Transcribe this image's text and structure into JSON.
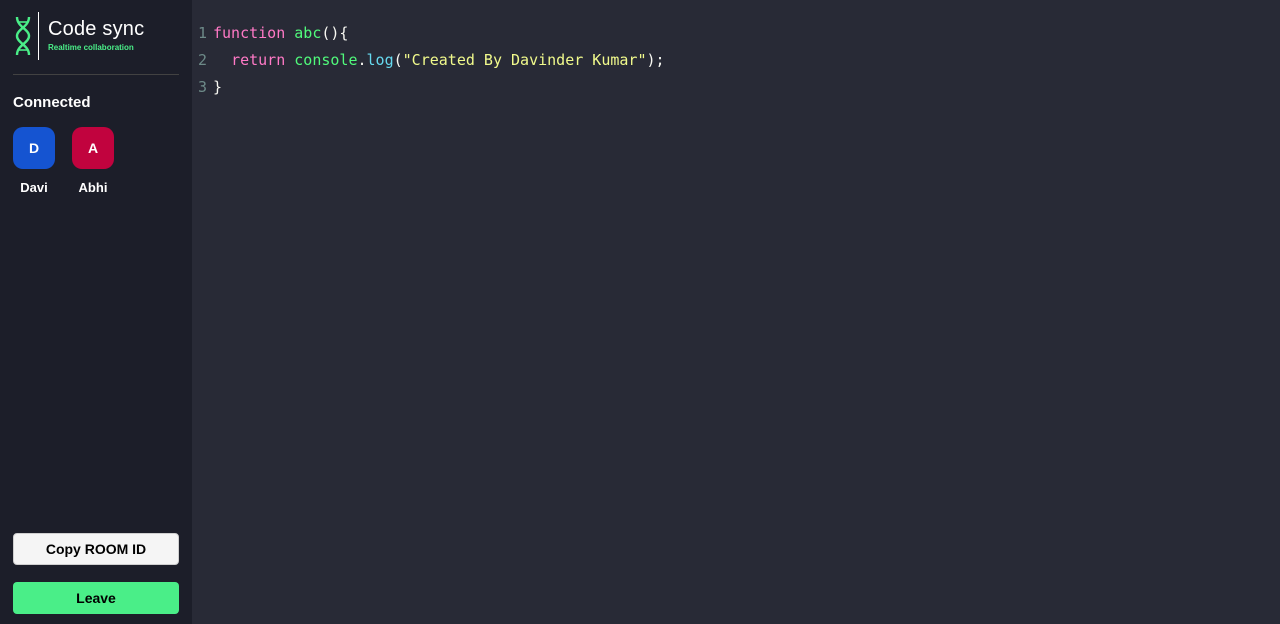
{
  "sidebar": {
    "logo": {
      "title": "Code sync",
      "subtitle": "Realtime collaboration",
      "icon": "dna-icon",
      "accent": "#4aee88"
    },
    "connected_label": "Connected",
    "clients": [
      {
        "initial": "D",
        "name": "Davi",
        "color": "#1554d1"
      },
      {
        "initial": "A",
        "name": "Abhi",
        "color": "#c1033e"
      }
    ],
    "copy_button_label": "Copy ROOM ID",
    "leave_button_label": "Leave"
  },
  "editor": {
    "lines": [
      {
        "number": "1",
        "tokens": [
          {
            "text": "function",
            "type": "kw"
          },
          {
            "text": " ",
            "type": "plain"
          },
          {
            "text": "abc",
            "type": "fn"
          },
          {
            "text": "(){",
            "type": "plain"
          }
        ]
      },
      {
        "number": "2",
        "tokens": [
          {
            "text": "  ",
            "type": "plain"
          },
          {
            "text": "return",
            "type": "kw"
          },
          {
            "text": " ",
            "type": "plain"
          },
          {
            "text": "console",
            "type": "fn"
          },
          {
            "text": ".",
            "type": "plain"
          },
          {
            "text": "log",
            "type": "prop"
          },
          {
            "text": "(",
            "type": "plain"
          },
          {
            "text": "\"Created By Davinder Kumar\"",
            "type": "str"
          },
          {
            "text": ");",
            "type": "plain"
          }
        ]
      },
      {
        "number": "3",
        "tokens": [
          {
            "text": "}",
            "type": "plain"
          }
        ]
      }
    ]
  }
}
